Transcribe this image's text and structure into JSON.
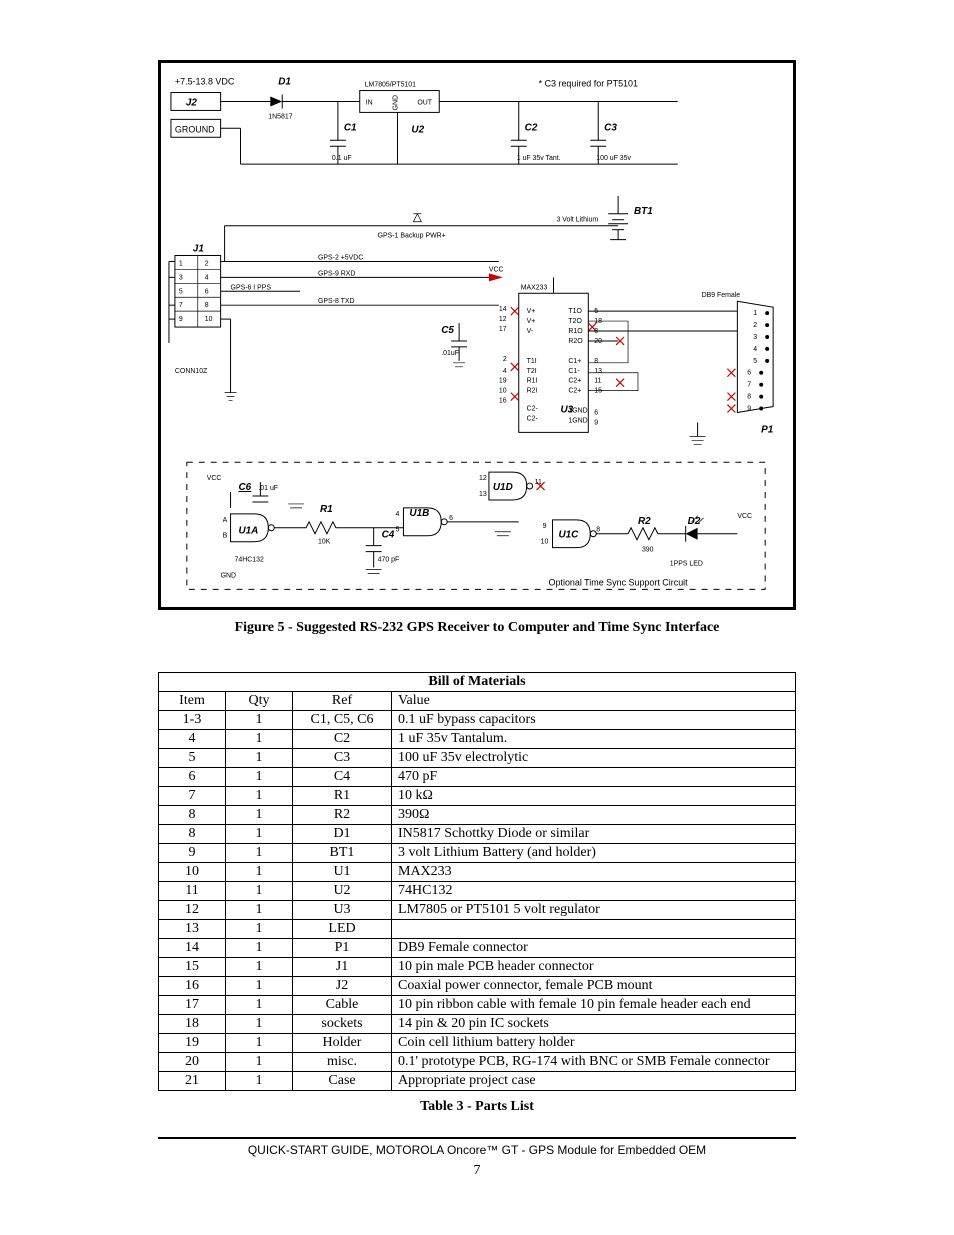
{
  "schematic": {
    "labels": {
      "vdc": "+7.5-13.8 VDC",
      "j2": "J2",
      "ground": "GROUND",
      "d1": "D1",
      "d1val": "1N5817",
      "reg": "LM7805/PT5101",
      "in": "IN",
      "gnd_pin": "GND",
      "out": "OUT",
      "u2": "U2",
      "c1": "C1",
      "c1val": "0.1 uF",
      "c2": "C2",
      "c2val": "1 uF 35v Tant.",
      "c3": "C3",
      "c3val": "100 uF 35v",
      "c3note": "* C3 required for PT5101",
      "bt1": "BT1",
      "bt1val": "3 Volt Lithium",
      "gps_backup": "GPS-1 Backup PWR+",
      "j1": "J1",
      "gps2": "GPS-2 +5VDC",
      "gps9": "GPS-9 RXD",
      "gps6": "GPS-6   I PPS",
      "gps8": "GPS-8 TXD",
      "conn10z": "CONN10Z",
      "c5": "C5",
      "c5val": ".01uF",
      "max233": "MAX233",
      "db9": "DB9 Female",
      "u3": "U3",
      "p1": "P1",
      "vcc1": "VCC",
      "vcc2": "VCC",
      "c6": "C6",
      "c6val": ".01 uF",
      "r1": "R1",
      "r1val": "10K",
      "u1a": "U1A",
      "u1b": "U1B",
      "u1c": "U1C",
      "u1d": "U1D",
      "c4": "C4",
      "c4val": "470 pF",
      "hc": "74HC132",
      "gnd_txt": "GND",
      "r2": "R2",
      "r2val": "390",
      "d2": "D2",
      "led": "1PPS LED",
      "optional": "Optional Time Sync Support Circuit"
    }
  },
  "figure_caption": "Figure 5 - Suggested RS-232 GPS Receiver to Computer and Time Sync Interface",
  "table": {
    "title": "Bill of Materials",
    "headers": {
      "item": "Item",
      "qty": "Qty",
      "ref": "Ref",
      "value": "Value"
    },
    "rows": [
      {
        "item": "1-3",
        "qty": "1",
        "ref": "C1, C5, C6",
        "value": "0.1 uF bypass capacitors"
      },
      {
        "item": "4",
        "qty": "1",
        "ref": "C2",
        "value": "1 uF 35v Tantalum."
      },
      {
        "item": "5",
        "qty": "1",
        "ref": "C3",
        "value": "100 uF 35v electrolytic"
      },
      {
        "item": "6",
        "qty": "1",
        "ref": "C4",
        "value": "470 pF"
      },
      {
        "item": "7",
        "qty": "1",
        "ref": "R1",
        "value": "10 kΩ"
      },
      {
        "item": "8",
        "qty": "1",
        "ref": "R2",
        "value": "390Ω"
      },
      {
        "item": "8",
        "qty": "1",
        "ref": "D1",
        "value": "IN5817 Schottky Diode or similar"
      },
      {
        "item": "9",
        "qty": "1",
        "ref": "BT1",
        "value": "3 volt Lithium Battery (and holder)"
      },
      {
        "item": "10",
        "qty": "1",
        "ref": "U1",
        "value": "MAX233"
      },
      {
        "item": "11",
        "qty": "1",
        "ref": "U2",
        "value": "74HC132"
      },
      {
        "item": "12",
        "qty": "1",
        "ref": "U3",
        "value": "LM7805 or PT5101 5 volt  regulator"
      },
      {
        "item": "13",
        "qty": "1",
        "ref": "LED",
        "value": ""
      },
      {
        "item": "14",
        "qty": "1",
        "ref": "P1",
        "value": "DB9 Female connector"
      },
      {
        "item": "15",
        "qty": "1",
        "ref": "J1",
        "value": "10 pin male PCB header connector"
      },
      {
        "item": "16",
        "qty": "1",
        "ref": "J2",
        "value": "Coaxial power connector, female PCB mount"
      },
      {
        "item": "17",
        "qty": "1",
        "ref": "Cable",
        "value": "10 pin ribbon cable with female 10 pin female header each end"
      },
      {
        "item": "18",
        "qty": "1",
        "ref": "sockets",
        "value": "14 pin & 20 pin IC sockets"
      },
      {
        "item": "19",
        "qty": "1",
        "ref": "Holder",
        "value": "Coin cell lithium battery holder"
      },
      {
        "item": "20",
        "qty": "1",
        "ref": "misc.",
        "value": "0.1' prototype PCB, RG-174 with BNC or SMB Female connector"
      },
      {
        "item": "21",
        "qty": "1",
        "ref": "Case",
        "value": "Appropriate project case"
      }
    ]
  },
  "table_caption": "Table 3 - Parts List",
  "footer": "QUICK-START GUIDE, MOTOROLA Oncore™ GT - GPS Module for Embedded OEM",
  "page_number": "7"
}
